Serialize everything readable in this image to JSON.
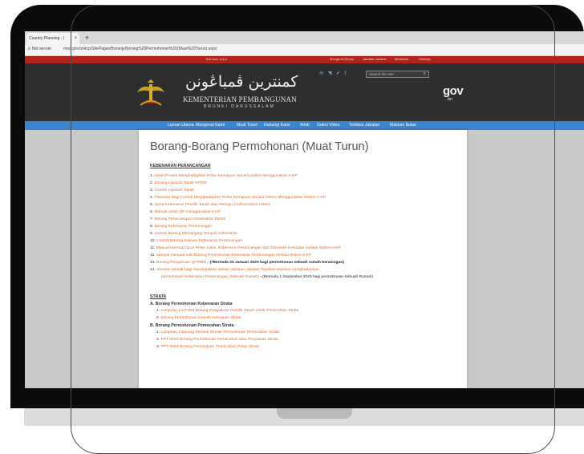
{
  "browser": {
    "tab_title": "Country Planning - (",
    "tab_close": "×",
    "new_tab": "+",
    "security": "⚠ Not secure",
    "url": "mod.gov.bn/tcp/SitePages/Borang-Borang%20Permohonan%20(Muat%20Turun).aspx"
  },
  "site": {
    "top_links": [
      "Text size: a  A  A",
      "Mengenai Brunei",
      "Jabatan-Jabatan",
      "Ministries",
      "Sitemap"
    ],
    "jawi_name": "كمنترين ڤمباڠونن",
    "ministry_name": "KEMENTERIAN PEMBANGUNAN",
    "country": "BRUNEI DARUSSALAM",
    "social_icons": "✉ ◥ ✔ f",
    "search_placeholder": "Search this site",
    "gov_logo": "gov",
    "gov_suffix": ".bn",
    "nav": [
      "Laman Utama",
      "Mengenai Kami",
      "Muat Turun",
      "Hubungi Kami",
      "Arkib",
      "Galeri Video",
      "Terbitan Jabatan",
      "Maklum Balas"
    ]
  },
  "content": {
    "title": "Borang-Borang Permohonan (Muat Turun)",
    "section1": "KEBENARAN PERANCANGAN",
    "items": [
      {
        "num": "1.",
        "text": "Aliran Proses Menghadapkan Pelan Kemajuan Secara Online Menggunakan e-KP",
        "extra": ""
      },
      {
        "num": "2.",
        "text": "Borang Laporan Tapak KP002",
        "extra": ""
      },
      {
        "num": "3.",
        "text": "Contoh Laporan Tapak",
        "extra": ""
      },
      {
        "num": "4.",
        "text": "Piawaian Bagi Format Menghadapkan Pelan Kemajuan Secara Online Menggunakan Sistem e-KP",
        "extra": ""
      },
      {
        "num": "5.",
        "text": "Surat Kebenaran Pemilik Tanah atau Pemaju (Authorization Letter)",
        "extra": ""
      },
      {
        "num": "6.",
        "text": "Manual untuk QP menggunakan e-KP",
        "extra": ""
      },
      {
        "num": "7.",
        "text": "Borang Perancangan Infrastruktur Eletrik",
        "extra": ""
      },
      {
        "num": "8.",
        "text": "Borang Kebenaran Perancangan",
        "extra": ""
      },
      {
        "num": "9.",
        "text": "Contoh Borang Memanjang Tempoh Kebenaran",
        "extra": ""
      },
      {
        "num": "10.",
        "text": "Contoh Borang Rayuan Kebenaran Perancangan",
        "extra": ""
      },
      {
        "num": "11.",
        "text": "Manual memuat turun Pelan Lukis, Kebenaran Perancangan dan Dokumen berkaitan melalui Sistem e-KP",
        "extra": ""
      },
      {
        "num": "12.",
        "text": "Manual memuat naik Borang Permohonan Kebenaran Perancangan melalui Sistem e-KP",
        "extra": ""
      },
      {
        "num": "13.",
        "text": "Borang Pengakuan QP/RBO",
        "extra": " - (*Bermula 03 Januari 2023 bagi permohonan sebuah rumah berasingan)"
      },
      {
        "num": "14.",
        "text": "Senarai Semak bagi mendapatkan ulasan Jabatan-Jabatan Teknikal sebelum menghadapkan",
        "extra": ""
      }
    ],
    "item14_cont": "permohonan Kebenaran Perancangan (Sebuah Rumah)",
    "item14_cont_extra": " - (Bermula 1 September 2020 bagi permohonan Sebuah Rumah)",
    "section2": "STRATA",
    "subA": "A. Borang Permohonan Kebenaran Strata",
    "subA_items": [
      {
        "num": "1.",
        "text": "Lampiran 1 KP 003 Borang Pengakuan Pemilik Tanah untuk Pemecahan Strata"
      },
      {
        "num": "2.",
        "text": "Borang Permohonan Insentif Kemajuan Strata"
      }
    ],
    "subB": "B. Borang Permohonan Pemecahan Strata",
    "subB_items": [
      {
        "num": "1.",
        "text": "Lampiran 1  Borang Senarai Semak Permohonan Pemecahan Strata"
      },
      {
        "num": "2.",
        "text": "PPT 001S Borang Permohonan Pemecahan atau Penyatuan Strata"
      },
      {
        "num": "3.",
        "text": "PPT 002S Borang Persetujuan Pemecahan Pelan Strata"
      }
    ]
  }
}
